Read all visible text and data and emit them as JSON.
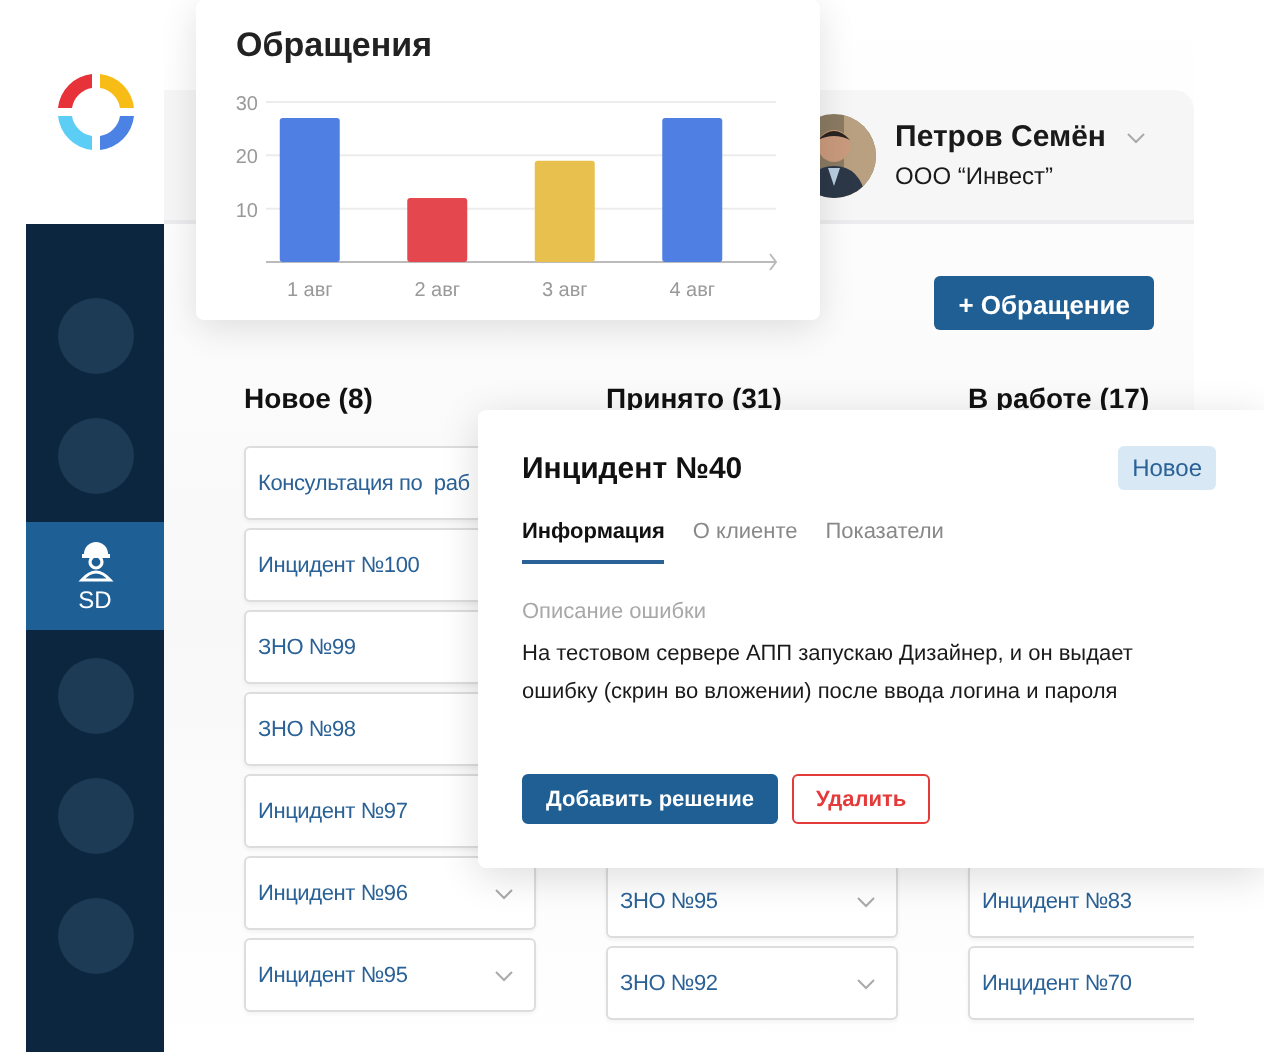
{
  "chart": {
    "title": "Обращения",
    "bars": [
      {
        "color": "#4f7fe3"
      },
      {
        "color": "#e4474d"
      },
      {
        "color": "#e8c04e"
      },
      {
        "color": "#4f7fe3"
      }
    ],
    "chart_data": {
      "type": "bar",
      "categories": [
        "1 авг",
        "2 авг",
        "3 авг",
        "4 авг"
      ],
      "series": [
        {
          "values": [
            27,
            12,
            19,
            27
          ]
        }
      ],
      "ylim": [
        0,
        30
      ],
      "yticks": [
        10,
        20,
        30
      ]
    }
  },
  "sidebar": {
    "items": [
      {
        "selected": false
      },
      {
        "selected": false
      },
      {
        "label": "SD",
        "selected": true
      },
      {
        "selected": false
      },
      {
        "selected": false
      },
      {
        "selected": false
      }
    ]
  },
  "user": {
    "name": "Петров Семён",
    "company": "ООО “Инвест”"
  },
  "new_button": "+ Обращение",
  "columns": [
    {
      "title": "Новое (8)",
      "cards": [
        {
          "kind": "plain",
          "text": "Консультация по  раб"
        },
        {
          "kind": "plain",
          "text": "Инцидент №100"
        },
        {
          "kind": "plain",
          "text": "ЗНО №99"
        },
        {
          "kind": "plain",
          "text": "ЗНО №98"
        },
        {
          "kind": "plain",
          "text": "Инцидент №97"
        },
        {
          "kind": "dropdown",
          "text": "Инцидент №96"
        },
        {
          "kind": "dropdown",
          "text": "Инцидент №95"
        }
      ]
    },
    {
      "title": "Принято (31)",
      "cards": [
        {
          "kind": "dropdown",
          "text": "ЗНО №95"
        },
        {
          "kind": "dropdown",
          "text": "ЗНО №92"
        }
      ]
    },
    {
      "title": "В работе (17)",
      "cards": [
        {
          "kind": "plain",
          "text": "Инцидент №83"
        },
        {
          "kind": "plain",
          "text": "Инцидент №70"
        }
      ]
    }
  ],
  "incident": {
    "title": "Инцидент №40",
    "status": "Новое",
    "tabs": [
      {
        "label": "Информация",
        "selected": true
      },
      {
        "label": "О клиенте",
        "selected": false
      },
      {
        "label": "Показатели",
        "selected": false
      }
    ],
    "field_label": "Описание ошибки",
    "description": "На тестовом сервере АПП запускаю Дизайнер, и он выдает ошибку (скрин во вложении) после ввода логина и пароля",
    "buttons": [
      {
        "kind": "primary",
        "label": "Добавить решение"
      },
      {
        "kind": "danger",
        "label": "Удалить"
      }
    ]
  }
}
